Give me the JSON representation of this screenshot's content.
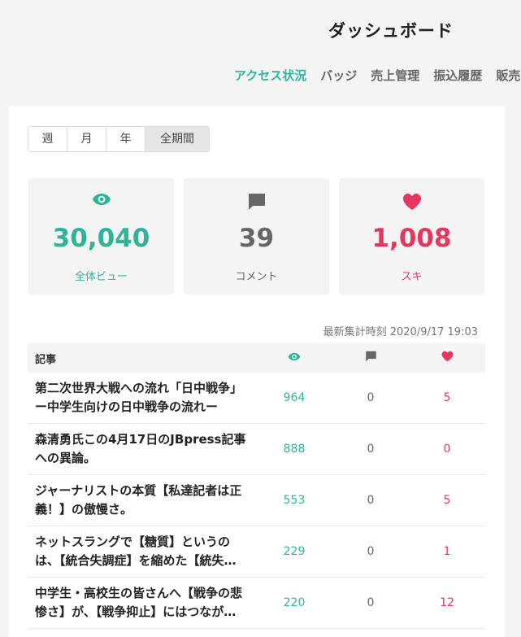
{
  "header": {
    "title": "ダッシュボード",
    "tabs": [
      "アクセス状況",
      "バッジ",
      "売上管理",
      "振込履歴",
      "販売"
    ]
  },
  "period": {
    "options": [
      "週",
      "月",
      "年",
      "全期間"
    ],
    "selected": "全期間"
  },
  "stats": {
    "views": {
      "value": "30,040",
      "label": "全体ビュー",
      "icon": "eye-icon"
    },
    "comments": {
      "value": "39",
      "label": "コメント",
      "icon": "comment-icon"
    },
    "likes": {
      "value": "1,008",
      "label": "スキ",
      "icon": "heart-icon"
    }
  },
  "updated": "最新集計時刻 2020/9/17 19:03",
  "table": {
    "header_article": "記事",
    "rows": [
      {
        "title": "第二次世界大戦への流れ「日中戦争」ー中学生向けの日中戦争の流れー",
        "views": "964",
        "comments": "0",
        "likes": "5"
      },
      {
        "title": "森清勇氏この4月17日のJBpress記事への異論。",
        "views": "888",
        "comments": "0",
        "likes": "0"
      },
      {
        "title": "ジャーナリストの本質【私達記者は正義！】の傲慢さ。",
        "views": "553",
        "comments": "0",
        "likes": "5"
      },
      {
        "title": "ネットスラングで【糖質】というのは、【統合失調症】を縮めた【統失】から…",
        "views": "229",
        "comments": "0",
        "likes": "1"
      },
      {
        "title": "中学生・高校生の皆さんへ【戦争の悲惨さ】が、【戦争抑止】にはつながらな…",
        "views": "220",
        "comments": "0",
        "likes": "12"
      }
    ]
  },
  "colors": {
    "accent": "#2cb696",
    "like": "#e5365f",
    "muted": "#666666"
  }
}
